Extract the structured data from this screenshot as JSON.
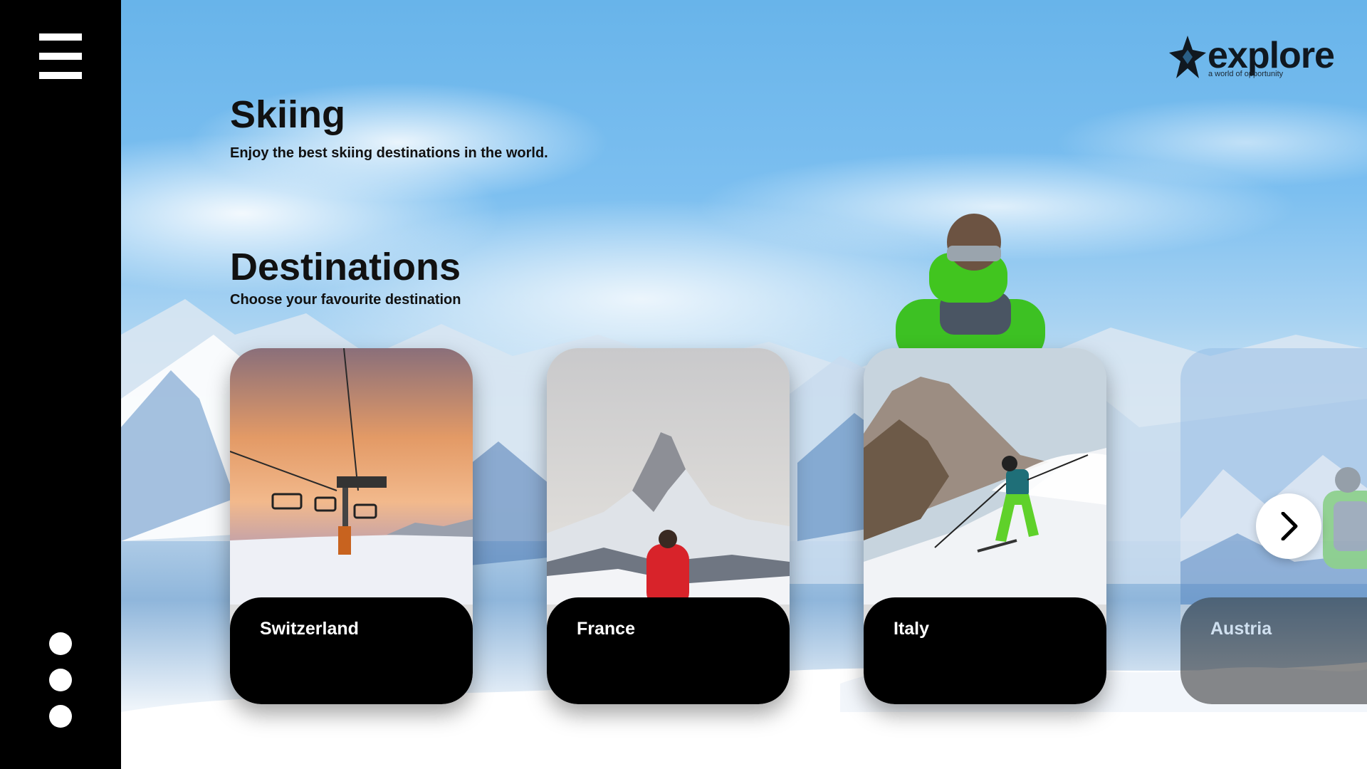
{
  "brand": {
    "name": "explore",
    "tagline": "a world of opportunity"
  },
  "hero": {
    "title": "Skiing",
    "subtitle": "Enjoy the best skiing destinations in the world."
  },
  "destinations": {
    "title": "Destinations",
    "subtitle": "Choose your favourite destination",
    "cards": [
      {
        "label": "Switzerland",
        "image": "chairlift-sunset"
      },
      {
        "label": "France",
        "image": "matterhorn-hiker"
      },
      {
        "label": "Italy",
        "image": "skier-powder"
      },
      {
        "label": "Austria",
        "image": "ski-tourer"
      }
    ]
  },
  "sidebar": {
    "menu_icon": "hamburger-icon",
    "page_dots": 3
  },
  "controls": {
    "next_icon": "chevron-right-icon"
  },
  "colors": {
    "rail": "#000000",
    "card_label_bg": "#000000",
    "text": "#111111",
    "sky": "#68b4ea"
  }
}
